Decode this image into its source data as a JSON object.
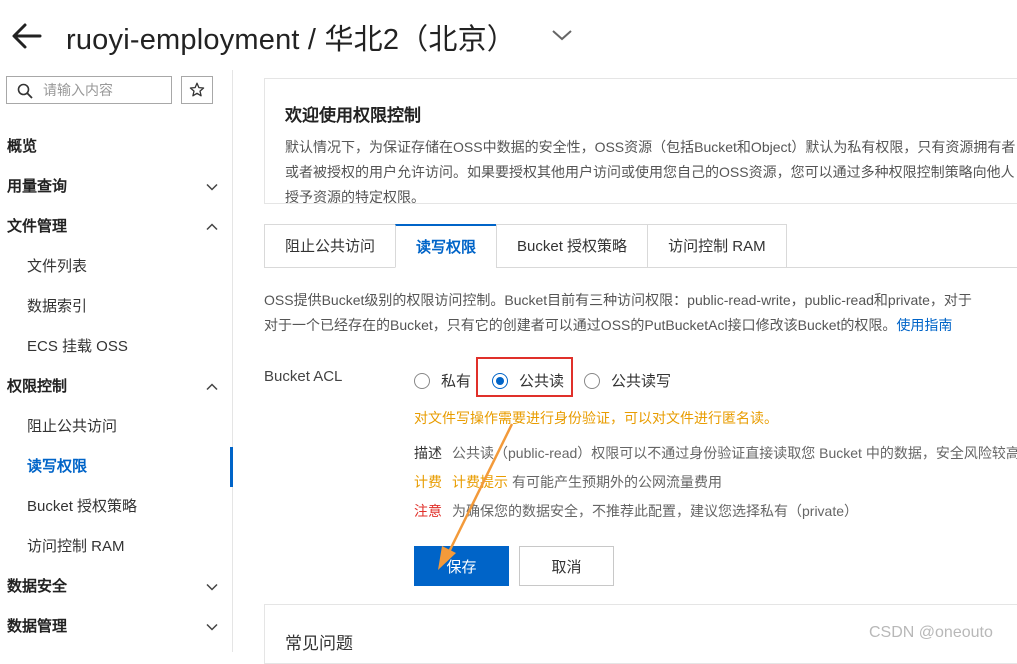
{
  "header": {
    "back_icon": "arrow-left-icon",
    "title": "ruoyi-employment / 华北2（北京）",
    "dropdown_icon": "chevron-down-icon"
  },
  "sidebar": {
    "search_placeholder": "请输入内容",
    "star_icon": "star-icon",
    "items": [
      {
        "label": "概览",
        "level": 1,
        "chevron": "none"
      },
      {
        "label": "用量查询",
        "level": 1,
        "chevron": "down"
      },
      {
        "label": "文件管理",
        "level": 1,
        "chevron": "up"
      },
      {
        "label": "文件列表",
        "level": 2
      },
      {
        "label": "数据索引",
        "level": 2
      },
      {
        "label": "ECS 挂载 OSS",
        "level": 2
      },
      {
        "label": "权限控制",
        "level": 1,
        "chevron": "up"
      },
      {
        "label": "阻止公共访问",
        "level": 2
      },
      {
        "label": "读写权限",
        "level": 2,
        "active": true
      },
      {
        "label": "Bucket 授权策略",
        "level": 2
      },
      {
        "label": "访问控制 RAM",
        "level": 2
      },
      {
        "label": "数据安全",
        "level": 1,
        "chevron": "down"
      },
      {
        "label": "数据管理",
        "level": 1,
        "chevron": "down"
      }
    ]
  },
  "welcome": {
    "title": "欢迎使用权限控制",
    "description": "默认情况下，为保证存储在OSS中数据的安全性，OSS资源（包括Bucket和Object）默认为私有权限，只有资源拥有者或者被授权的用户允许访问。如果要授权其他用户访问或使用您自己的OSS资源，您可以通过多种权限控制策略向他人授予资源的特定权限。"
  },
  "tabs": [
    {
      "label": "阻止公共访问",
      "active": false
    },
    {
      "label": "读写权限",
      "active": true
    },
    {
      "label": "Bucket 授权策略",
      "active": false
    },
    {
      "label": "访问控制 RAM",
      "active": false
    }
  ],
  "intro": {
    "line1": "OSS提供Bucket级别的权限访问控制。Bucket目前有三种访问权限：public-read-write，public-read和private，对于",
    "line2": "对于一个已经存在的Bucket，只有它的创建者可以通过OSS的PutBucketAcl接口修改该Bucket的权限。",
    "link": "使用指南"
  },
  "acl": {
    "label": "Bucket ACL",
    "options": [
      {
        "label": "私有",
        "checked": false
      },
      {
        "label": "公共读",
        "checked": true
      },
      {
        "label": "公共读写",
        "checked": false
      }
    ],
    "warning": "对文件写操作需要进行身份验证，可以对文件进行匿名读。",
    "desc_key": "描述",
    "desc_text": "公共读（public-read）权限可以不通过身份验证直接读取您 Bucket 中的数据，安全风险较高，",
    "billing_key": "计费",
    "billing_tag": "计费提示",
    "billing_text": "有可能产生预期外的公网流量费用",
    "note_key": "注意",
    "note_text": "为确保您的数据安全，不推荐此配置，建议您选择私有（private）"
  },
  "buttons": {
    "save": "保存",
    "cancel": "取消"
  },
  "faq": {
    "title": "常见问题"
  },
  "watermark": "CSDN @oneouto",
  "colors": {
    "accent": "#0064c8",
    "warning": "#e89c00",
    "danger": "#e0302a",
    "arrow": "#f39a3a"
  }
}
